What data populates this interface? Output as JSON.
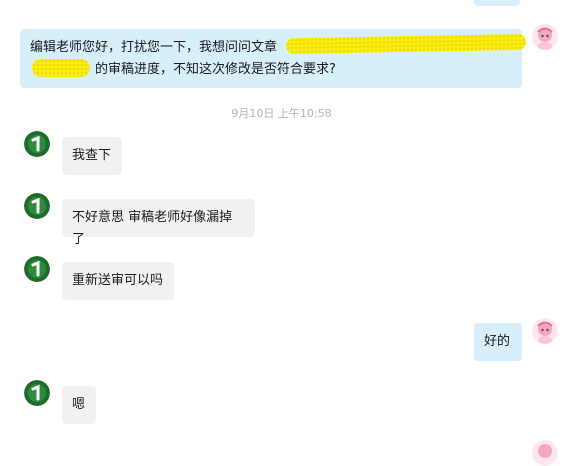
{
  "conversation": {
    "messages": [
      {
        "id": "m1",
        "sender": "me",
        "lines": [
          "编辑老师您好，打扰您一下，我想问问文章",
          "的审稿进度，不知这次修改是否符合要求?"
        ]
      },
      {
        "id": "m2",
        "sender": "other",
        "text": "我查下"
      },
      {
        "id": "m3",
        "sender": "other",
        "text": "不好意思 审稿老师好像漏掉了"
      },
      {
        "id": "m4",
        "sender": "other",
        "text": "重新送审可以吗"
      },
      {
        "id": "m5",
        "sender": "me",
        "text": "好的"
      },
      {
        "id": "m6",
        "sender": "other",
        "text": "嗯"
      }
    ],
    "timestamp": "9月10日  上午10:58"
  },
  "colors": {
    "my_bubble": "#d7eefb",
    "their_bubble": "#f1f1f1",
    "timestamp_text": "#b3b3b3",
    "redaction": "#ffee00"
  }
}
